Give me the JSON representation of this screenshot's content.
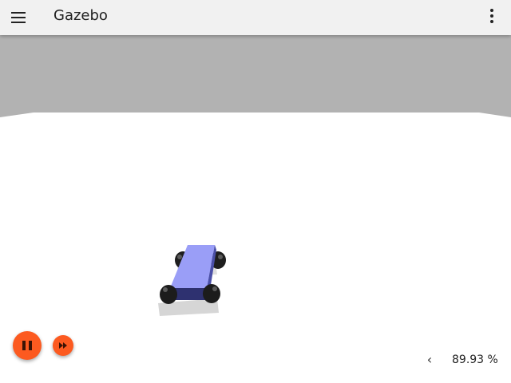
{
  "app": {
    "title": "Gazebo"
  },
  "icons": {
    "menu": "hamburger-menu-icon",
    "more": "vertical-dots-icon",
    "play_pause": "pause-icon",
    "step": "fast-forward-icon",
    "stats_toggle": "chevron-left-icon"
  },
  "toolbar": {
    "stats_toggle_glyph": "‹",
    "real_time_factor": "89.93 %"
  },
  "colors": {
    "header_bg": "#f1f1f1",
    "accent": "#fc5a20",
    "sky": "#b2b2b2",
    "ground": "#ffffff",
    "chassis": "#9a9ef7"
  }
}
